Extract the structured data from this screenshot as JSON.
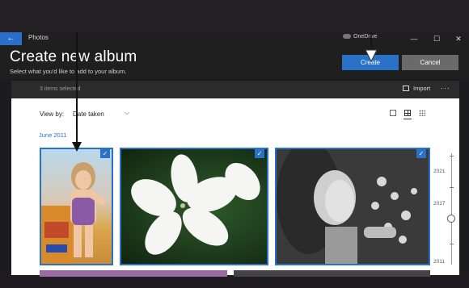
{
  "window": {
    "app_title": "Photos",
    "back_icon": "back-arrow-icon",
    "onedrive_label": "OneDrive",
    "controls": {
      "minimize": "—",
      "maximize": "☐",
      "close": "✕"
    }
  },
  "header": {
    "title": "Create new album",
    "subtitle": "Select what you'd like to add to your album.",
    "create_label": "Create",
    "cancel_label": "Cancel"
  },
  "toolbar": {
    "selection_count": "3 items selected",
    "import_label": "Import",
    "more_label": "···"
  },
  "view": {
    "viewby_label": "View by:",
    "viewby_value": "Date taken",
    "chevron": "⌵"
  },
  "group": {
    "date": "June 2011"
  },
  "photos": [
    {
      "name": "photo-girl-swimsuit",
      "selected": true
    },
    {
      "name": "photo-white-flower",
      "selected": true
    },
    {
      "name": "photo-girl-with-flowers-bw",
      "selected": true
    }
  ],
  "timeline": {
    "years": [
      "2021",
      "2017",
      "2011"
    ]
  },
  "colors": {
    "accent": "#2a71c8",
    "background": "#1f1f1f",
    "content": "#ffffff"
  }
}
